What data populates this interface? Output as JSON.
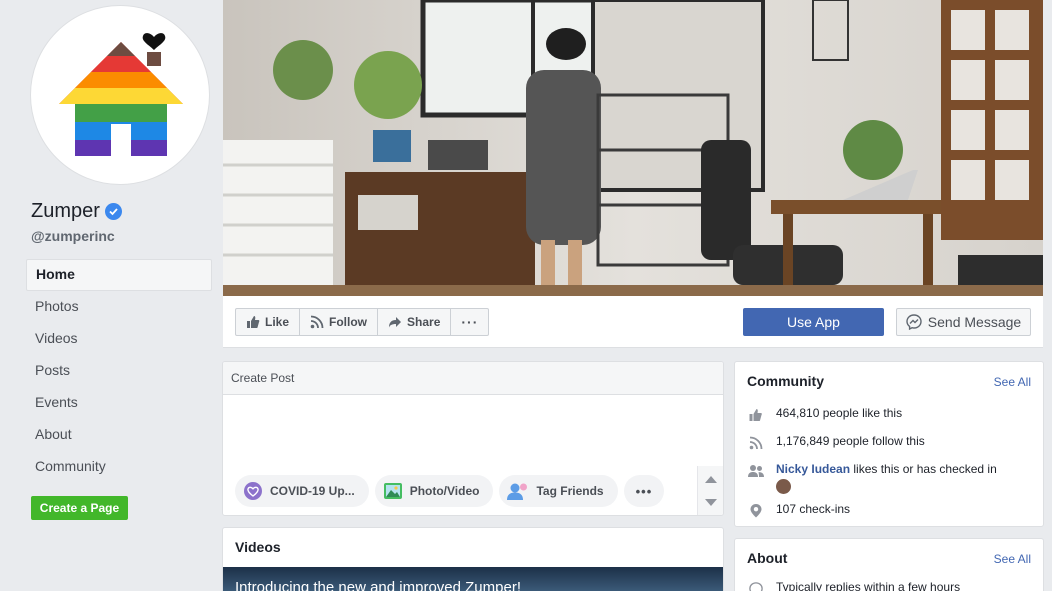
{
  "page": {
    "name": "Zumper",
    "handle": "@zumperinc",
    "logo_colors": [
      "#e53935",
      "#fb8c00",
      "#fdd835",
      "#43a047",
      "#1e88e5",
      "#5e35b1"
    ]
  },
  "nav": {
    "items": [
      {
        "label": "Home",
        "active": true
      },
      {
        "label": "Photos"
      },
      {
        "label": "Videos"
      },
      {
        "label": "Posts"
      },
      {
        "label": "Events"
      },
      {
        "label": "About"
      },
      {
        "label": "Community"
      }
    ],
    "create_page": "Create a Page"
  },
  "actions": {
    "like": "Like",
    "follow": "Follow",
    "share": "Share",
    "more": "···",
    "use_app": "Use App",
    "send_message": "Send Message"
  },
  "create_post": {
    "title": "Create Post",
    "buttons": [
      "COVID-19 Up...",
      "Photo/Video",
      "Tag Friends"
    ],
    "more": "•••"
  },
  "videos": {
    "title": "Videos",
    "caption": "Introducing the new and improved Zumper!"
  },
  "community": {
    "title": "Community",
    "see_all": "See All",
    "likes": "464,810 people like this",
    "follows": "1,176,849 people follow this",
    "friend_name": "Nicky Iudean",
    "friend_text": " likes this or has checked in",
    "checkins": "107 check-ins"
  },
  "about": {
    "title": "About",
    "see_all": "See All",
    "replies": "Typically replies within a few hours"
  }
}
